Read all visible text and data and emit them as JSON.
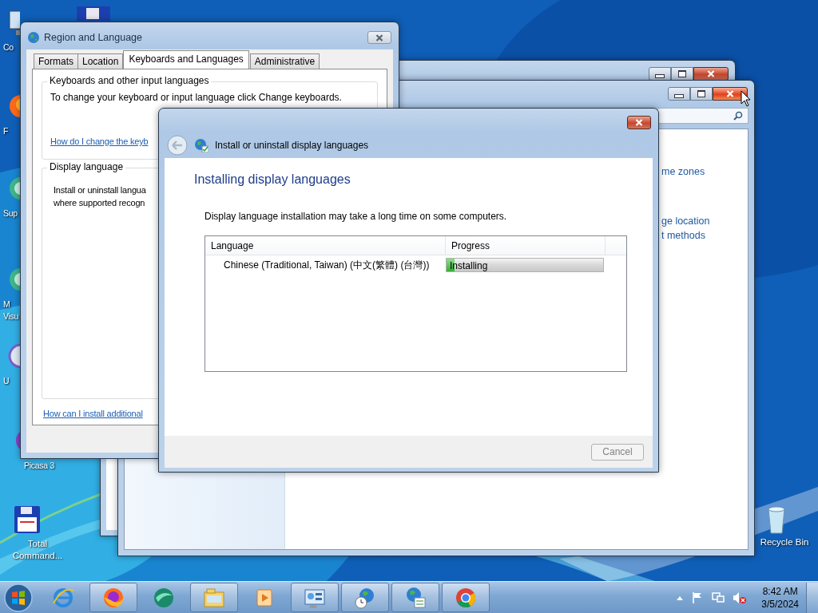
{
  "desktop_icons": [
    {
      "kind": "computer",
      "lines": [
        "Co"
      ]
    },
    {
      "kind": "firefox",
      "lines": [
        "F"
      ]
    },
    {
      "kind": "globe",
      "lines": [
        "Sup"
      ]
    },
    {
      "kind": "globe",
      "lines": [
        "M",
        "Visu"
      ]
    },
    {
      "kind": "disc",
      "lines": [
        "U"
      ]
    },
    {
      "kind": "picasa",
      "lines": [
        "Picasa 3"
      ]
    },
    {
      "kind": "floppy",
      "lines": [
        "Total",
        "Command..."
      ]
    },
    {
      "kind": "recycle",
      "lines": [
        "Recycle Bin"
      ]
    }
  ],
  "control_panel": {
    "links": [
      "me zones",
      "ge location",
      "t methods"
    ]
  },
  "region_window": {
    "title": "Region and Language",
    "tabs": [
      {
        "label": "Formats",
        "selected": false
      },
      {
        "label": "Location",
        "selected": false
      },
      {
        "label": "Keyboards and Languages",
        "selected": true
      },
      {
        "label": "Administrative",
        "selected": false
      }
    ],
    "keyboards_group": {
      "title": "Keyboards and other input languages",
      "text": "To change your keyboard or input language click Change keyboards.",
      "link": "How do I change the keyb"
    },
    "display_group": {
      "title": "Display language",
      "text_lines": [
        "Install or uninstall langua",
        "where supported recogn"
      ]
    },
    "bottom_link": "How can I install additional"
  },
  "dialog": {
    "title": "Install or uninstall display languages",
    "heading": "Installing display languages",
    "description": "Display language installation may take a long time on some computers.",
    "columns": [
      "Language",
      "Progress"
    ],
    "rows": [
      {
        "language": "Chinese (Traditional, Taiwan) (中文(繁體) (台灣))",
        "status": "Installing",
        "level": 0.05
      }
    ],
    "cancel": {
      "label": "Cancel",
      "disabled": true
    }
  },
  "taskbar": {
    "items": [
      {
        "kind": "ie",
        "running": false
      },
      {
        "kind": "firefox",
        "running": true
      },
      {
        "kind": "green",
        "running": false
      },
      {
        "kind": "explorer",
        "running": true
      },
      {
        "kind": "media",
        "running": false
      },
      {
        "kind": "control",
        "running": true
      },
      {
        "kind": "globeclock",
        "running": true
      },
      {
        "kind": "globelist",
        "running": true
      },
      {
        "kind": "chrome",
        "running": true
      }
    ],
    "time": "8:42 AM",
    "date": "3/5/2024"
  }
}
